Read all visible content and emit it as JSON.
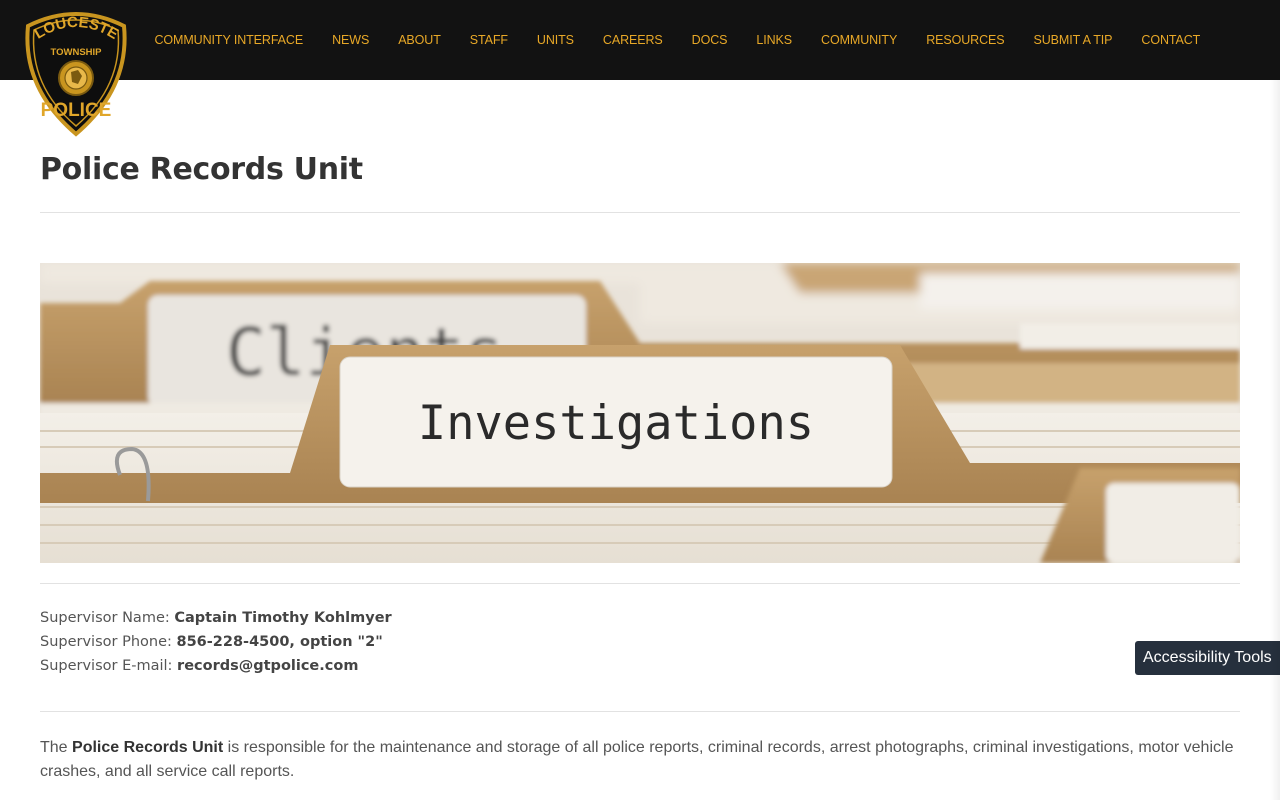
{
  "header": {
    "logo": {
      "line1": "GLOUCESTER",
      "line2": "TOWNSHIP",
      "line3": "POLICE"
    },
    "nav": [
      {
        "label": "COMMUNITY INTERFACE"
      },
      {
        "label": "NEWS"
      },
      {
        "label": "ABOUT"
      },
      {
        "label": "STAFF"
      },
      {
        "label": "UNITS"
      },
      {
        "label": "CAREERS"
      },
      {
        "label": "DOCS"
      },
      {
        "label": "LINKS"
      },
      {
        "label": "COMMUNITY"
      },
      {
        "label": "RESOURCES"
      },
      {
        "label": "SUBMIT A TIP"
      },
      {
        "label": "CONTACT"
      }
    ]
  },
  "page": {
    "title": "Police Records Unit"
  },
  "hero": {
    "front_tab": "Investigations",
    "back_tab": "Clients"
  },
  "supervisor": {
    "name_label": "Supervisor Name:",
    "name": "Captain Timothy Kohlmyer",
    "phone_label": "Supervisor Phone:",
    "phone": "856-228-4500, option \"2\"",
    "email_label": "Supervisor E-mail:",
    "email": "records@gtpolice.com"
  },
  "description": {
    "prefix": "The",
    "unit": "Police Records Unit",
    "text": "is responsible for the maintenance and storage of all police reports, criminal records, arrest photographs, criminal investigations, motor vehicle crashes, and all service call reports."
  },
  "accessibility": {
    "label": "Accessibility Tools"
  },
  "colors": {
    "nav_bg": "#121212",
    "nav_link": "#e8a827",
    "a11y_bg": "#26303d"
  }
}
